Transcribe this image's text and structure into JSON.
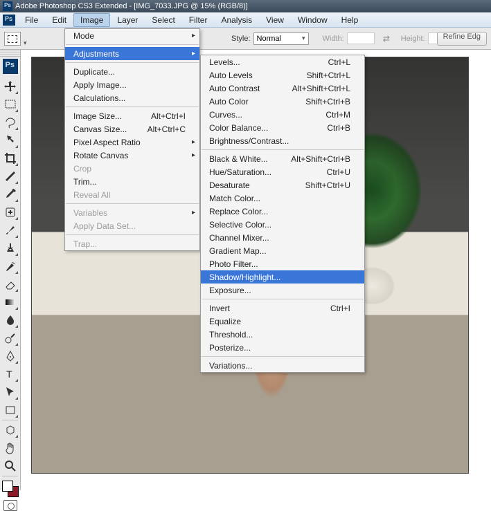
{
  "titlebar": {
    "title": "Adobe Photoshop CS3 Extended - [IMG_7033.JPG @ 15% (RGB/8)]"
  },
  "menubar": {
    "items": [
      "File",
      "Edit",
      "Image",
      "Layer",
      "Select",
      "Filter",
      "Analysis",
      "View",
      "Window",
      "Help"
    ],
    "open_index": 2
  },
  "optionsbar": {
    "style_label": "Style:",
    "style_value": "Normal",
    "width_label": "Width:",
    "width_value": "",
    "height_label": "Height:",
    "height_value": "",
    "refine_label": "Refine Edg"
  },
  "image_menu": [
    {
      "label": "Mode",
      "submenu": true
    },
    {
      "sep": true
    },
    {
      "label": "Adjustments",
      "submenu": true,
      "highlight": true
    },
    {
      "sep": true
    },
    {
      "label": "Duplicate..."
    },
    {
      "label": "Apply Image..."
    },
    {
      "label": "Calculations..."
    },
    {
      "sep": true
    },
    {
      "label": "Image Size...",
      "shortcut": "Alt+Ctrl+I"
    },
    {
      "label": "Canvas Size...",
      "shortcut": "Alt+Ctrl+C"
    },
    {
      "label": "Pixel Aspect Ratio",
      "submenu": true
    },
    {
      "label": "Rotate Canvas",
      "submenu": true
    },
    {
      "label": "Crop",
      "disabled": true
    },
    {
      "label": "Trim..."
    },
    {
      "label": "Reveal All",
      "disabled": true
    },
    {
      "sep": true
    },
    {
      "label": "Variables",
      "submenu": true,
      "disabled": true
    },
    {
      "label": "Apply Data Set...",
      "disabled": true
    },
    {
      "sep": true
    },
    {
      "label": "Trap...",
      "disabled": true
    }
  ],
  "adjustments_menu": [
    {
      "label": "Levels...",
      "shortcut": "Ctrl+L"
    },
    {
      "label": "Auto Levels",
      "shortcut": "Shift+Ctrl+L"
    },
    {
      "label": "Auto Contrast",
      "shortcut": "Alt+Shift+Ctrl+L"
    },
    {
      "label": "Auto Color",
      "shortcut": "Shift+Ctrl+B"
    },
    {
      "label": "Curves...",
      "shortcut": "Ctrl+M"
    },
    {
      "label": "Color Balance...",
      "shortcut": "Ctrl+B"
    },
    {
      "label": "Brightness/Contrast..."
    },
    {
      "sep": true
    },
    {
      "label": "Black & White...",
      "shortcut": "Alt+Shift+Ctrl+B"
    },
    {
      "label": "Hue/Saturation...",
      "shortcut": "Ctrl+U"
    },
    {
      "label": "Desaturate",
      "shortcut": "Shift+Ctrl+U"
    },
    {
      "label": "Match Color..."
    },
    {
      "label": "Replace Color..."
    },
    {
      "label": "Selective Color..."
    },
    {
      "label": "Channel Mixer..."
    },
    {
      "label": "Gradient Map..."
    },
    {
      "label": "Photo Filter..."
    },
    {
      "label": "Shadow/Highlight...",
      "highlight": true
    },
    {
      "label": "Exposure..."
    },
    {
      "sep": true
    },
    {
      "label": "Invert",
      "shortcut": "Ctrl+I"
    },
    {
      "label": "Equalize"
    },
    {
      "label": "Threshold..."
    },
    {
      "label": "Posterize..."
    },
    {
      "sep": true
    },
    {
      "label": "Variations..."
    }
  ],
  "tools": [
    "move-tool",
    "marquee-tool",
    "lasso-tool",
    "quick-select-tool",
    "crop-tool",
    "slice-tool",
    "eyedropper-tool",
    "healing-brush-tool",
    "brush-tool",
    "clone-stamp-tool",
    "history-brush-tool",
    "eraser-tool",
    "gradient-tool",
    "blur-tool",
    "dodge-tool",
    "pen-tool",
    "type-tool",
    "path-select-tool",
    "shape-tool",
    "3d-tool",
    "hand-tool",
    "zoom-tool"
  ],
  "colors": {
    "foreground": "#ffffff",
    "background": "#8a1a2a"
  }
}
